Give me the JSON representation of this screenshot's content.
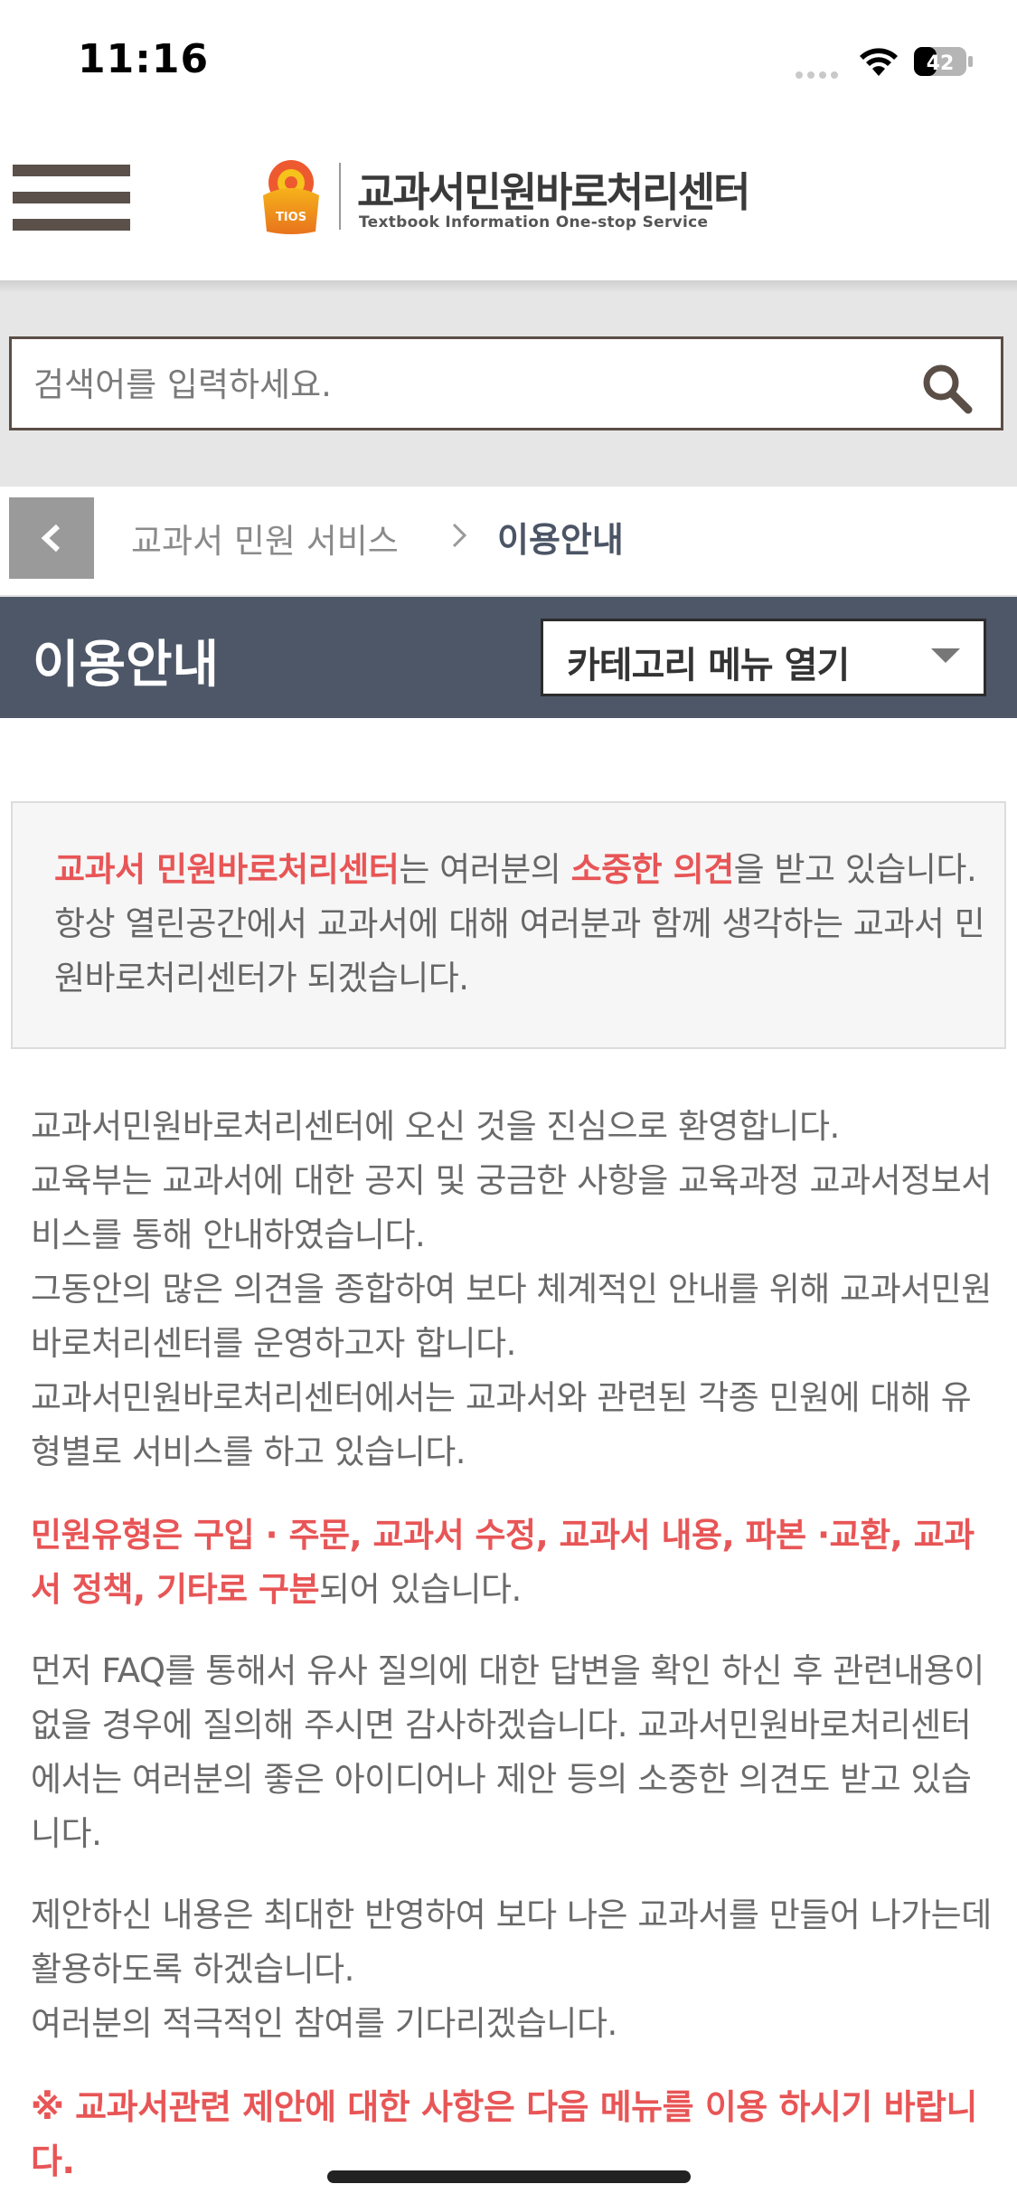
{
  "status_bar": {
    "time": "11:16",
    "battery": "42"
  },
  "header": {
    "logo_title": "교과서민원바로처리센터",
    "logo_subtitle": "Textbook Information One-stop Service",
    "logo_mark_text": "TIOS"
  },
  "search": {
    "placeholder": "검색어를 입력하세요."
  },
  "breadcrumb": {
    "parent": "교과서 민원 서비스",
    "current": "이용안내"
  },
  "page": {
    "title": "이용안내",
    "category_menu_label": "카테고리 메뉴 열기"
  },
  "intro": {
    "hl1": "교과서 민원바로처리센터",
    "t1": "는 여러분의 ",
    "hl2": "소중한 의견",
    "t2": "을 받고 있습니다. 항상 열린공간에서 교과서에 대해 여러분과 함께 생각하는 교과서 민원바로처리센터가 되겠습니다."
  },
  "body": {
    "p1": [
      "교과서민원바로처리센터에 오신 것을 진심으로 환영합니다.",
      "교육부는 교과서에 대한 공지 및 궁금한 사항을 교육과정 교과서정보서비스를 통해 안내하였습니다.",
      "그동안의 많은 의견을 종합하여 보다 체계적인 안내를 위해 교과서민원바로처리센터를 운영하고자 합니다.",
      "교과서민원바로처리센터에서는 교과서와 관련된 각종 민원에 대해 유형별로 서비스를 하고 있습니다."
    ],
    "p2_red": "민원유형은 구입 · 주문, 교과서 수정, 교과서 내용, 파본 ·교환, 교과서 정책, 기타로 구분",
    "p2_tail": "되어 있습니다.",
    "p3": "먼저 FAQ를 통해서 유사 질의에 대한 답변을 확인 하신 후 관련내용이 없을 경우에 질의해 주시면 감사하겠습니다. 교과서민원바로처리센터에서는 여러분의 좋은 아이디어나 제안 등의 소중한 의견도 받고 있습니다.",
    "p4": [
      "제안하신 내용은 최대한 반영하여 보다 나은 교과서를 만들어 나가는데 활용하도록 하겠습니다.",
      "여러분의 적극적인 참여를 기다리겠습니다."
    ],
    "notice": "※ 교과서관련 제안에 대한 사항은 다음 메뉴를 이용 하시기 바랍니다."
  }
}
